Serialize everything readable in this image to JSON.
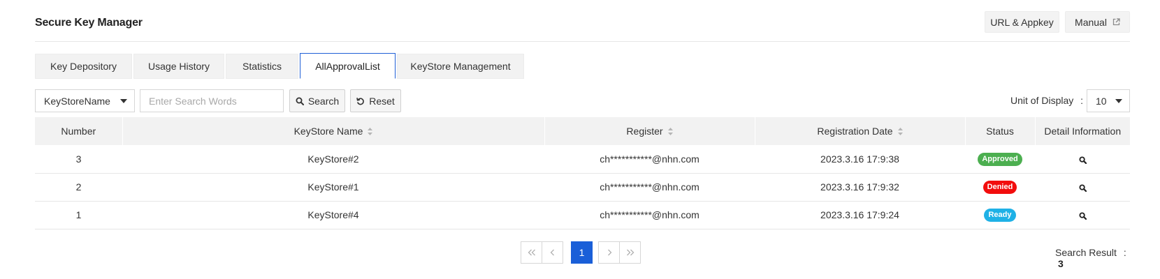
{
  "header": {
    "title": "Secure Key Manager",
    "url_button": "URL & Appkey",
    "manual_button": "Manual"
  },
  "tabs": [
    {
      "label": "Key Depository",
      "active": false
    },
    {
      "label": "Usage History",
      "active": false
    },
    {
      "label": "Statistics",
      "active": false
    },
    {
      "label": "AllApprovalList",
      "active": true
    },
    {
      "label": "KeyStore Management",
      "active": false
    }
  ],
  "search": {
    "field_select": "KeyStoreName",
    "placeholder": "Enter Search Words",
    "value": "",
    "search_button": "Search",
    "reset_button": "Reset"
  },
  "display": {
    "label": "Unit of Display",
    "separator": ":",
    "value": "10"
  },
  "table": {
    "columns": [
      "Number",
      "KeyStore Name",
      "Register",
      "Registration Date",
      "Status",
      "Detail Information"
    ],
    "rows": [
      {
        "number": "3",
        "name": "KeyStore#2",
        "register": "ch***********@nhn.com",
        "date": "2023.3.16 17:9:38",
        "status": "Approved"
      },
      {
        "number": "2",
        "name": "KeyStore#1",
        "register": "ch***********@nhn.com",
        "date": "2023.3.16 17:9:32",
        "status": "Denied"
      },
      {
        "number": "1",
        "name": "KeyStore#4",
        "register": "ch***********@nhn.com",
        "date": "2023.3.16 17:9:24",
        "status": "Ready"
      }
    ]
  },
  "status_colors": {
    "Approved": "#4caf50",
    "Denied": "#f20d0d",
    "Ready": "#1fb1e6"
  },
  "accent_color": "#1a5fd8",
  "pagination": {
    "current": "1",
    "first_icon": "double-chevron-left-icon",
    "prev_icon": "chevron-left-icon",
    "next_icon": "chevron-right-icon",
    "last_icon": "double-chevron-right-icon"
  },
  "result": {
    "label": "Search Result",
    "separator": ":",
    "count": "3"
  }
}
